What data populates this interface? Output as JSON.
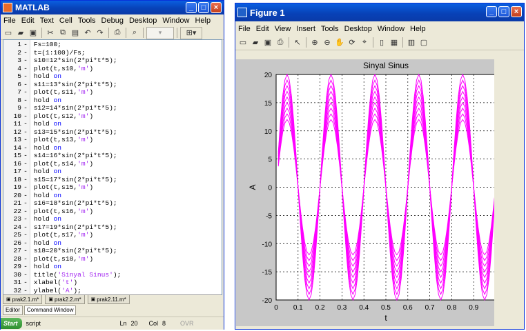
{
  "matlab": {
    "title": "MATLAB",
    "menu": [
      "File",
      "Edit",
      "Text",
      "Cell",
      "Tools",
      "Debug",
      "Desktop",
      "Window",
      "Help"
    ],
    "code_lines": [
      {
        "n": "1",
        "text": "Fs=100;"
      },
      {
        "n": "2",
        "text": "t=(1:100)/Fs;"
      },
      {
        "n": "3",
        "text": "s10=12*sin(2*pi*t*5);"
      },
      {
        "n": "4",
        "text": "plot(t,s10,",
        "str": "'m'",
        "tail": ")"
      },
      {
        "n": "5",
        "text": "hold ",
        "kw": "on"
      },
      {
        "n": "6",
        "text": "s11=13*sin(2*pi*t*5);"
      },
      {
        "n": "7",
        "text": "plot(t,s11,",
        "str": "'m'",
        "tail": ")"
      },
      {
        "n": "8",
        "text": "hold ",
        "kw": "on"
      },
      {
        "n": "9",
        "text": "s12=14*sin(2*pi*t*5);"
      },
      {
        "n": "10",
        "text": "plot(t,s12,",
        "str": "'m'",
        "tail": ")"
      },
      {
        "n": "11",
        "text": "hold ",
        "kw": "on"
      },
      {
        "n": "12",
        "text": "s13=15*sin(2*pi*t*5);"
      },
      {
        "n": "13",
        "text": "plot(t,s13,",
        "str": "'m'",
        "tail": ")"
      },
      {
        "n": "14",
        "text": "hold ",
        "kw": "on"
      },
      {
        "n": "15",
        "text": "s14=16*sin(2*pi*t*5);"
      },
      {
        "n": "16",
        "text": "plot(t,s14,",
        "str": "'m'",
        "tail": ")"
      },
      {
        "n": "17",
        "text": "hold ",
        "kw": "on"
      },
      {
        "n": "18",
        "text": "s15=17*sin(2*pi*t*5);"
      },
      {
        "n": "19",
        "text": "plot(t,s15,",
        "str": "'m'",
        "tail": ")"
      },
      {
        "n": "20",
        "text": "hold ",
        "kw": "on"
      },
      {
        "n": "21",
        "text": "s16=18*sin(2*pi*t*5);"
      },
      {
        "n": "22",
        "text": "plot(t,s16,",
        "str": "'m'",
        "tail": ")"
      },
      {
        "n": "23",
        "text": "hold ",
        "kw": "on"
      },
      {
        "n": "24",
        "text": "s17=19*sin(2*pi*t*5);"
      },
      {
        "n": "25",
        "text": "plot(t,s17,",
        "str": "'m'",
        "tail": ")"
      },
      {
        "n": "26",
        "text": "hold ",
        "kw": "on"
      },
      {
        "n": "27",
        "text": "s18=20*sin(2*pi*t*5);"
      },
      {
        "n": "28",
        "text": "plot(t,s18,",
        "str": "'m'",
        "tail": ")"
      },
      {
        "n": "29",
        "text": "hold ",
        "kw": "on"
      },
      {
        "n": "30",
        "text": "title(",
        "str": "'Sinyal Sinus'",
        "tail": ");"
      },
      {
        "n": "31",
        "text": "xlabel(",
        "str": "'t'",
        "tail": ")"
      },
      {
        "n": "32",
        "text": "ylabel(",
        "str": "'A'",
        "tail": ");"
      }
    ],
    "file_tabs": [
      "prak2.1.m*",
      "prak2.2.m*",
      "prak2.11.m*"
    ],
    "bottom_tabs": [
      "Editor",
      "Command Window"
    ],
    "status": {
      "start": "Start",
      "mode": "script",
      "ln": "Ln",
      "ln_val": "20",
      "col": "Col",
      "col_val": "8",
      "ovr": "OVR"
    }
  },
  "figure": {
    "title": "Figure 1",
    "menu": [
      "File",
      "Edit",
      "View",
      "Insert",
      "Tools",
      "Desktop",
      "Window",
      "Help"
    ]
  },
  "chart_data": {
    "type": "line",
    "title": "Sinyal Sinus",
    "xlabel": "t",
    "ylabel": "A",
    "xlim": [
      0,
      1
    ],
    "ylim": [
      -20,
      20
    ],
    "xticks": [
      "0",
      "0.1",
      "0.2",
      "0.3",
      "0.4",
      "0.5",
      "0.6",
      "0.7",
      "0.8",
      "0.9",
      "1"
    ],
    "yticks": [
      "20",
      "15",
      "10",
      "5",
      "0",
      "-5",
      "-10",
      "-15",
      "-20"
    ],
    "grid": true,
    "color": "#ff00ff",
    "x": "t = (1:100)/100",
    "series": [
      {
        "amplitude": 12,
        "frequency": 5
      },
      {
        "amplitude": 13,
        "frequency": 5
      },
      {
        "amplitude": 14,
        "frequency": 5
      },
      {
        "amplitude": 15,
        "frequency": 5
      },
      {
        "amplitude": 16,
        "frequency": 5
      },
      {
        "amplitude": 17,
        "frequency": 5
      },
      {
        "amplitude": 18,
        "frequency": 5
      },
      {
        "amplitude": 19,
        "frequency": 5
      },
      {
        "amplitude": 20,
        "frequency": 5
      }
    ]
  }
}
